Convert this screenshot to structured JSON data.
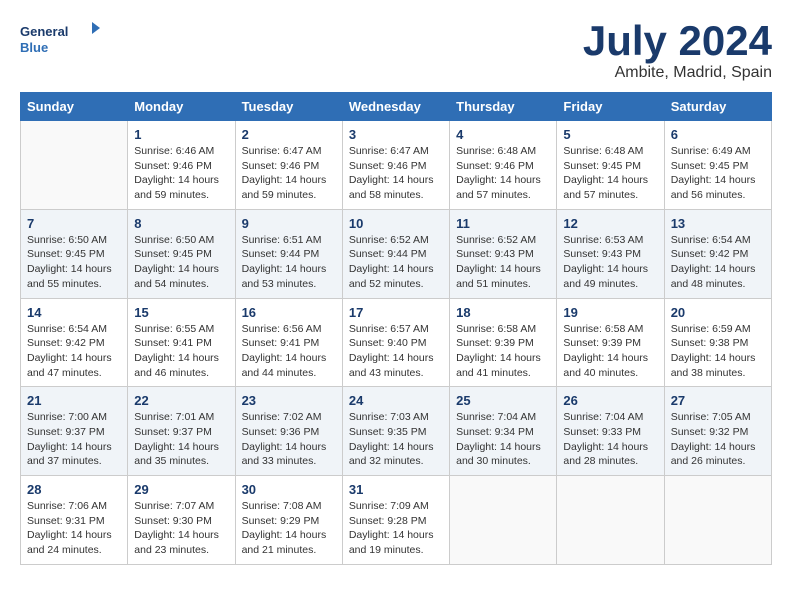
{
  "header": {
    "logo_line1": "General",
    "logo_line2": "Blue",
    "month": "July 2024",
    "location": "Ambite, Madrid, Spain"
  },
  "days_of_week": [
    "Sunday",
    "Monday",
    "Tuesday",
    "Wednesday",
    "Thursday",
    "Friday",
    "Saturday"
  ],
  "weeks": [
    [
      {
        "day": "",
        "info": ""
      },
      {
        "day": "1",
        "info": "Sunrise: 6:46 AM\nSunset: 9:46 PM\nDaylight: 14 hours\nand 59 minutes."
      },
      {
        "day": "2",
        "info": "Sunrise: 6:47 AM\nSunset: 9:46 PM\nDaylight: 14 hours\nand 59 minutes."
      },
      {
        "day": "3",
        "info": "Sunrise: 6:47 AM\nSunset: 9:46 PM\nDaylight: 14 hours\nand 58 minutes."
      },
      {
        "day": "4",
        "info": "Sunrise: 6:48 AM\nSunset: 9:46 PM\nDaylight: 14 hours\nand 57 minutes."
      },
      {
        "day": "5",
        "info": "Sunrise: 6:48 AM\nSunset: 9:45 PM\nDaylight: 14 hours\nand 57 minutes."
      },
      {
        "day": "6",
        "info": "Sunrise: 6:49 AM\nSunset: 9:45 PM\nDaylight: 14 hours\nand 56 minutes."
      }
    ],
    [
      {
        "day": "7",
        "info": "Sunrise: 6:50 AM\nSunset: 9:45 PM\nDaylight: 14 hours\nand 55 minutes."
      },
      {
        "day": "8",
        "info": "Sunrise: 6:50 AM\nSunset: 9:45 PM\nDaylight: 14 hours\nand 54 minutes."
      },
      {
        "day": "9",
        "info": "Sunrise: 6:51 AM\nSunset: 9:44 PM\nDaylight: 14 hours\nand 53 minutes."
      },
      {
        "day": "10",
        "info": "Sunrise: 6:52 AM\nSunset: 9:44 PM\nDaylight: 14 hours\nand 52 minutes."
      },
      {
        "day": "11",
        "info": "Sunrise: 6:52 AM\nSunset: 9:43 PM\nDaylight: 14 hours\nand 51 minutes."
      },
      {
        "day": "12",
        "info": "Sunrise: 6:53 AM\nSunset: 9:43 PM\nDaylight: 14 hours\nand 49 minutes."
      },
      {
        "day": "13",
        "info": "Sunrise: 6:54 AM\nSunset: 9:42 PM\nDaylight: 14 hours\nand 48 minutes."
      }
    ],
    [
      {
        "day": "14",
        "info": "Sunrise: 6:54 AM\nSunset: 9:42 PM\nDaylight: 14 hours\nand 47 minutes."
      },
      {
        "day": "15",
        "info": "Sunrise: 6:55 AM\nSunset: 9:41 PM\nDaylight: 14 hours\nand 46 minutes."
      },
      {
        "day": "16",
        "info": "Sunrise: 6:56 AM\nSunset: 9:41 PM\nDaylight: 14 hours\nand 44 minutes."
      },
      {
        "day": "17",
        "info": "Sunrise: 6:57 AM\nSunset: 9:40 PM\nDaylight: 14 hours\nand 43 minutes."
      },
      {
        "day": "18",
        "info": "Sunrise: 6:58 AM\nSunset: 9:39 PM\nDaylight: 14 hours\nand 41 minutes."
      },
      {
        "day": "19",
        "info": "Sunrise: 6:58 AM\nSunset: 9:39 PM\nDaylight: 14 hours\nand 40 minutes."
      },
      {
        "day": "20",
        "info": "Sunrise: 6:59 AM\nSunset: 9:38 PM\nDaylight: 14 hours\nand 38 minutes."
      }
    ],
    [
      {
        "day": "21",
        "info": "Sunrise: 7:00 AM\nSunset: 9:37 PM\nDaylight: 14 hours\nand 37 minutes."
      },
      {
        "day": "22",
        "info": "Sunrise: 7:01 AM\nSunset: 9:37 PM\nDaylight: 14 hours\nand 35 minutes."
      },
      {
        "day": "23",
        "info": "Sunrise: 7:02 AM\nSunset: 9:36 PM\nDaylight: 14 hours\nand 33 minutes."
      },
      {
        "day": "24",
        "info": "Sunrise: 7:03 AM\nSunset: 9:35 PM\nDaylight: 14 hours\nand 32 minutes."
      },
      {
        "day": "25",
        "info": "Sunrise: 7:04 AM\nSunset: 9:34 PM\nDaylight: 14 hours\nand 30 minutes."
      },
      {
        "day": "26",
        "info": "Sunrise: 7:04 AM\nSunset: 9:33 PM\nDaylight: 14 hours\nand 28 minutes."
      },
      {
        "day": "27",
        "info": "Sunrise: 7:05 AM\nSunset: 9:32 PM\nDaylight: 14 hours\nand 26 minutes."
      }
    ],
    [
      {
        "day": "28",
        "info": "Sunrise: 7:06 AM\nSunset: 9:31 PM\nDaylight: 14 hours\nand 24 minutes."
      },
      {
        "day": "29",
        "info": "Sunrise: 7:07 AM\nSunset: 9:30 PM\nDaylight: 14 hours\nand 23 minutes."
      },
      {
        "day": "30",
        "info": "Sunrise: 7:08 AM\nSunset: 9:29 PM\nDaylight: 14 hours\nand 21 minutes."
      },
      {
        "day": "31",
        "info": "Sunrise: 7:09 AM\nSunset: 9:28 PM\nDaylight: 14 hours\nand 19 minutes."
      },
      {
        "day": "",
        "info": ""
      },
      {
        "day": "",
        "info": ""
      },
      {
        "day": "",
        "info": ""
      }
    ]
  ]
}
